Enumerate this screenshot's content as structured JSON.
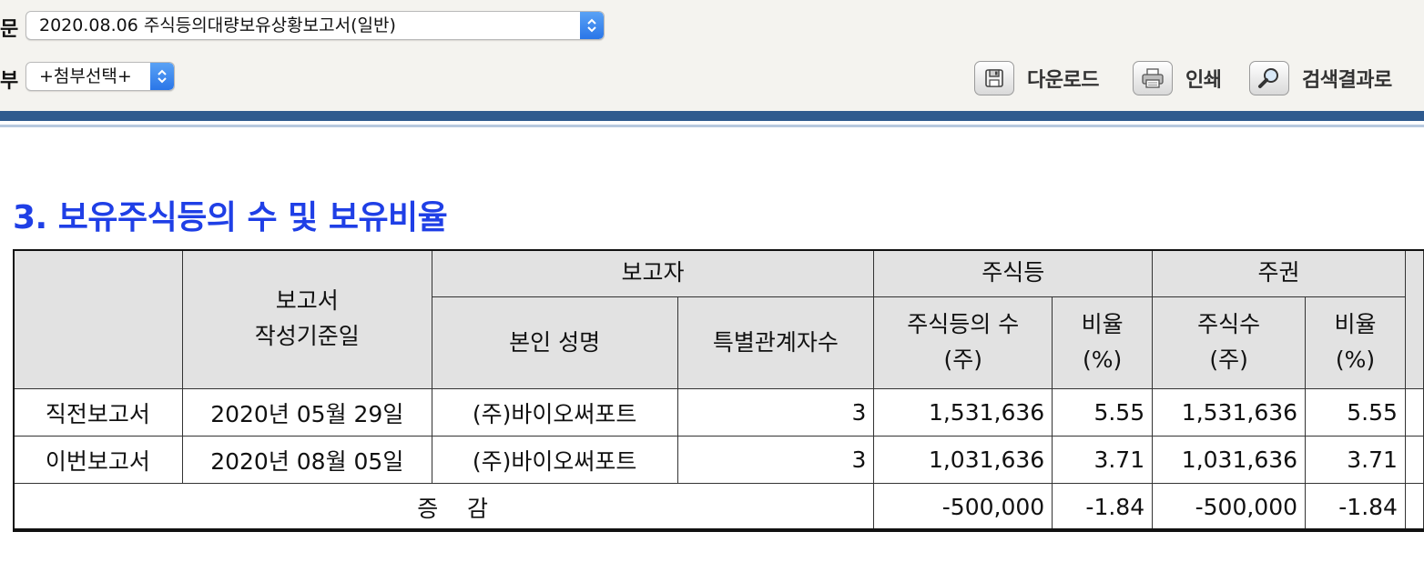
{
  "toolbar": {
    "doc_label": "문",
    "doc_select_value": "2020.08.06  주식등의대량보유상황보고서(일반)",
    "attach_label": "부",
    "attach_select_value": "+첨부선택+",
    "download_label": "다운로드",
    "print_label": "인쇄",
    "search_result_label": "검색결과로"
  },
  "section": {
    "title": "3. 보유주식등의 수 및 보유비율"
  },
  "table": {
    "head": {
      "report_date_line1": "보고서",
      "report_date_line2": "작성기준일",
      "reporter": "보고자",
      "reporter_name": "본인 성명",
      "related_count": "특별관계자수",
      "stocks": "주식등",
      "stocks_count_line1": "주식등의 수",
      "stocks_count_line2": "(주)",
      "stocks_ratio_line1": "비율",
      "stocks_ratio_line2": "(%)",
      "shares": "주권",
      "shares_count_line1": "주식수",
      "shares_count_line2": "(주)",
      "shares_ratio_line1": "비율",
      "shares_ratio_line2": "(%)"
    },
    "rows": [
      {
        "label": "직전보고서",
        "date": "2020년 05월 29일",
        "name": "(주)바이오써포트",
        "related": "3",
        "stock_count": "1,531,636",
        "stock_ratio": "5.55",
        "share_count": "1,531,636",
        "share_ratio": "5.55"
      },
      {
        "label": "이번보고서",
        "date": "2020년 08월 05일",
        "name": "(주)바이오써포트",
        "related": "3",
        "stock_count": "1,031,636",
        "stock_ratio": "3.71",
        "share_count": "1,031,636",
        "share_ratio": "3.71"
      }
    ],
    "change": {
      "label": "증    감",
      "stock_count": "-500,000",
      "stock_ratio": "-1.84",
      "share_count": "-500,000",
      "share_ratio": "-1.84"
    }
  },
  "icons": {
    "download": "floppy-disk-icon",
    "print": "printer-icon",
    "search": "magnifier-icon",
    "select_arrows": "updown-chevron-icon"
  },
  "colors": {
    "title": "#1f3fe6",
    "header_band": "#2e5a8e",
    "table_header_bg": "#e2e2e2",
    "select_arrow": "#2a76e8"
  }
}
